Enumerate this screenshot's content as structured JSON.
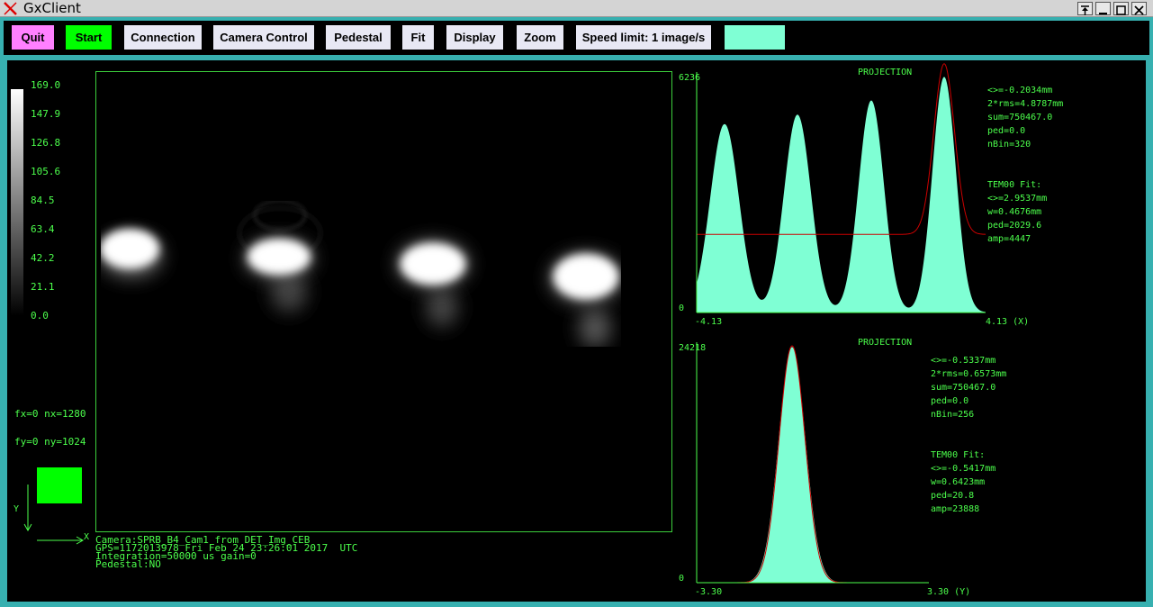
{
  "window": {
    "title": "GxClient"
  },
  "toolbar": {
    "quit_label": "Quit",
    "start_label": "Start",
    "connection_label": "Connection",
    "camera_control_label": "Camera Control",
    "pedestal_label": "Pedestal",
    "fit_label": "Fit",
    "display_label": "Display",
    "zoom_label": "Zoom",
    "speed_label": "Speed limit: 1 image/s",
    "quit_color": "#ff80ff",
    "start_color": "#00ff00",
    "status_color": "#7fffd4"
  },
  "colorbar": {
    "ticks": [
      "169.0",
      "147.9",
      "126.8",
      "105.6",
      "84.5",
      "63.4",
      "42.2",
      "21.1",
      "0.0"
    ]
  },
  "cursor": {
    "fx_line": "fx=0 nx=1280",
    "fy_line": "fy=0 ny=1024"
  },
  "axes": {
    "x_label": "X",
    "y_label": "Y"
  },
  "image_info": {
    "camera": "Camera:SPRB_B4_Cam1 from DET_Img_CEB",
    "gps": "GPS=1172013978 Fri Feb 24 23:26:01 2017  UTC",
    "integration": "Integration=50000 us gain=0",
    "pedestal": "Pedestal:NO"
  },
  "proj_x": {
    "title": "PROJECTION",
    "ymax_label": "6236",
    "ymin_label": "0",
    "xmin_label": "-4.13",
    "xmax_label": "4.13 (X)",
    "stats": [
      "<>=-0.2034mm",
      "2*rms=4.8787mm",
      "sum=750467.0",
      "ped=0.0",
      "nBin=320"
    ],
    "fit": [
      "TEM00 Fit:",
      "<>=2.9537mm",
      "w=0.4676mm",
      "ped=2029.6",
      "amp=4447"
    ]
  },
  "proj_y": {
    "title": "PROJECTION",
    "ymax_label": "24218",
    "ymin_label": "0",
    "xmin_label": "-3.30",
    "xmax_label": "3.30 (Y)",
    "stats": [
      "<>=-0.5337mm",
      "2*rms=0.6573mm",
      "sum=750467.0",
      "ped=0.0",
      "nBin=256"
    ],
    "fit": [
      "TEM00 Fit:",
      "<>=-0.5417mm",
      "w=0.6423mm",
      "ped=20.8",
      "amp=23888"
    ]
  }
}
